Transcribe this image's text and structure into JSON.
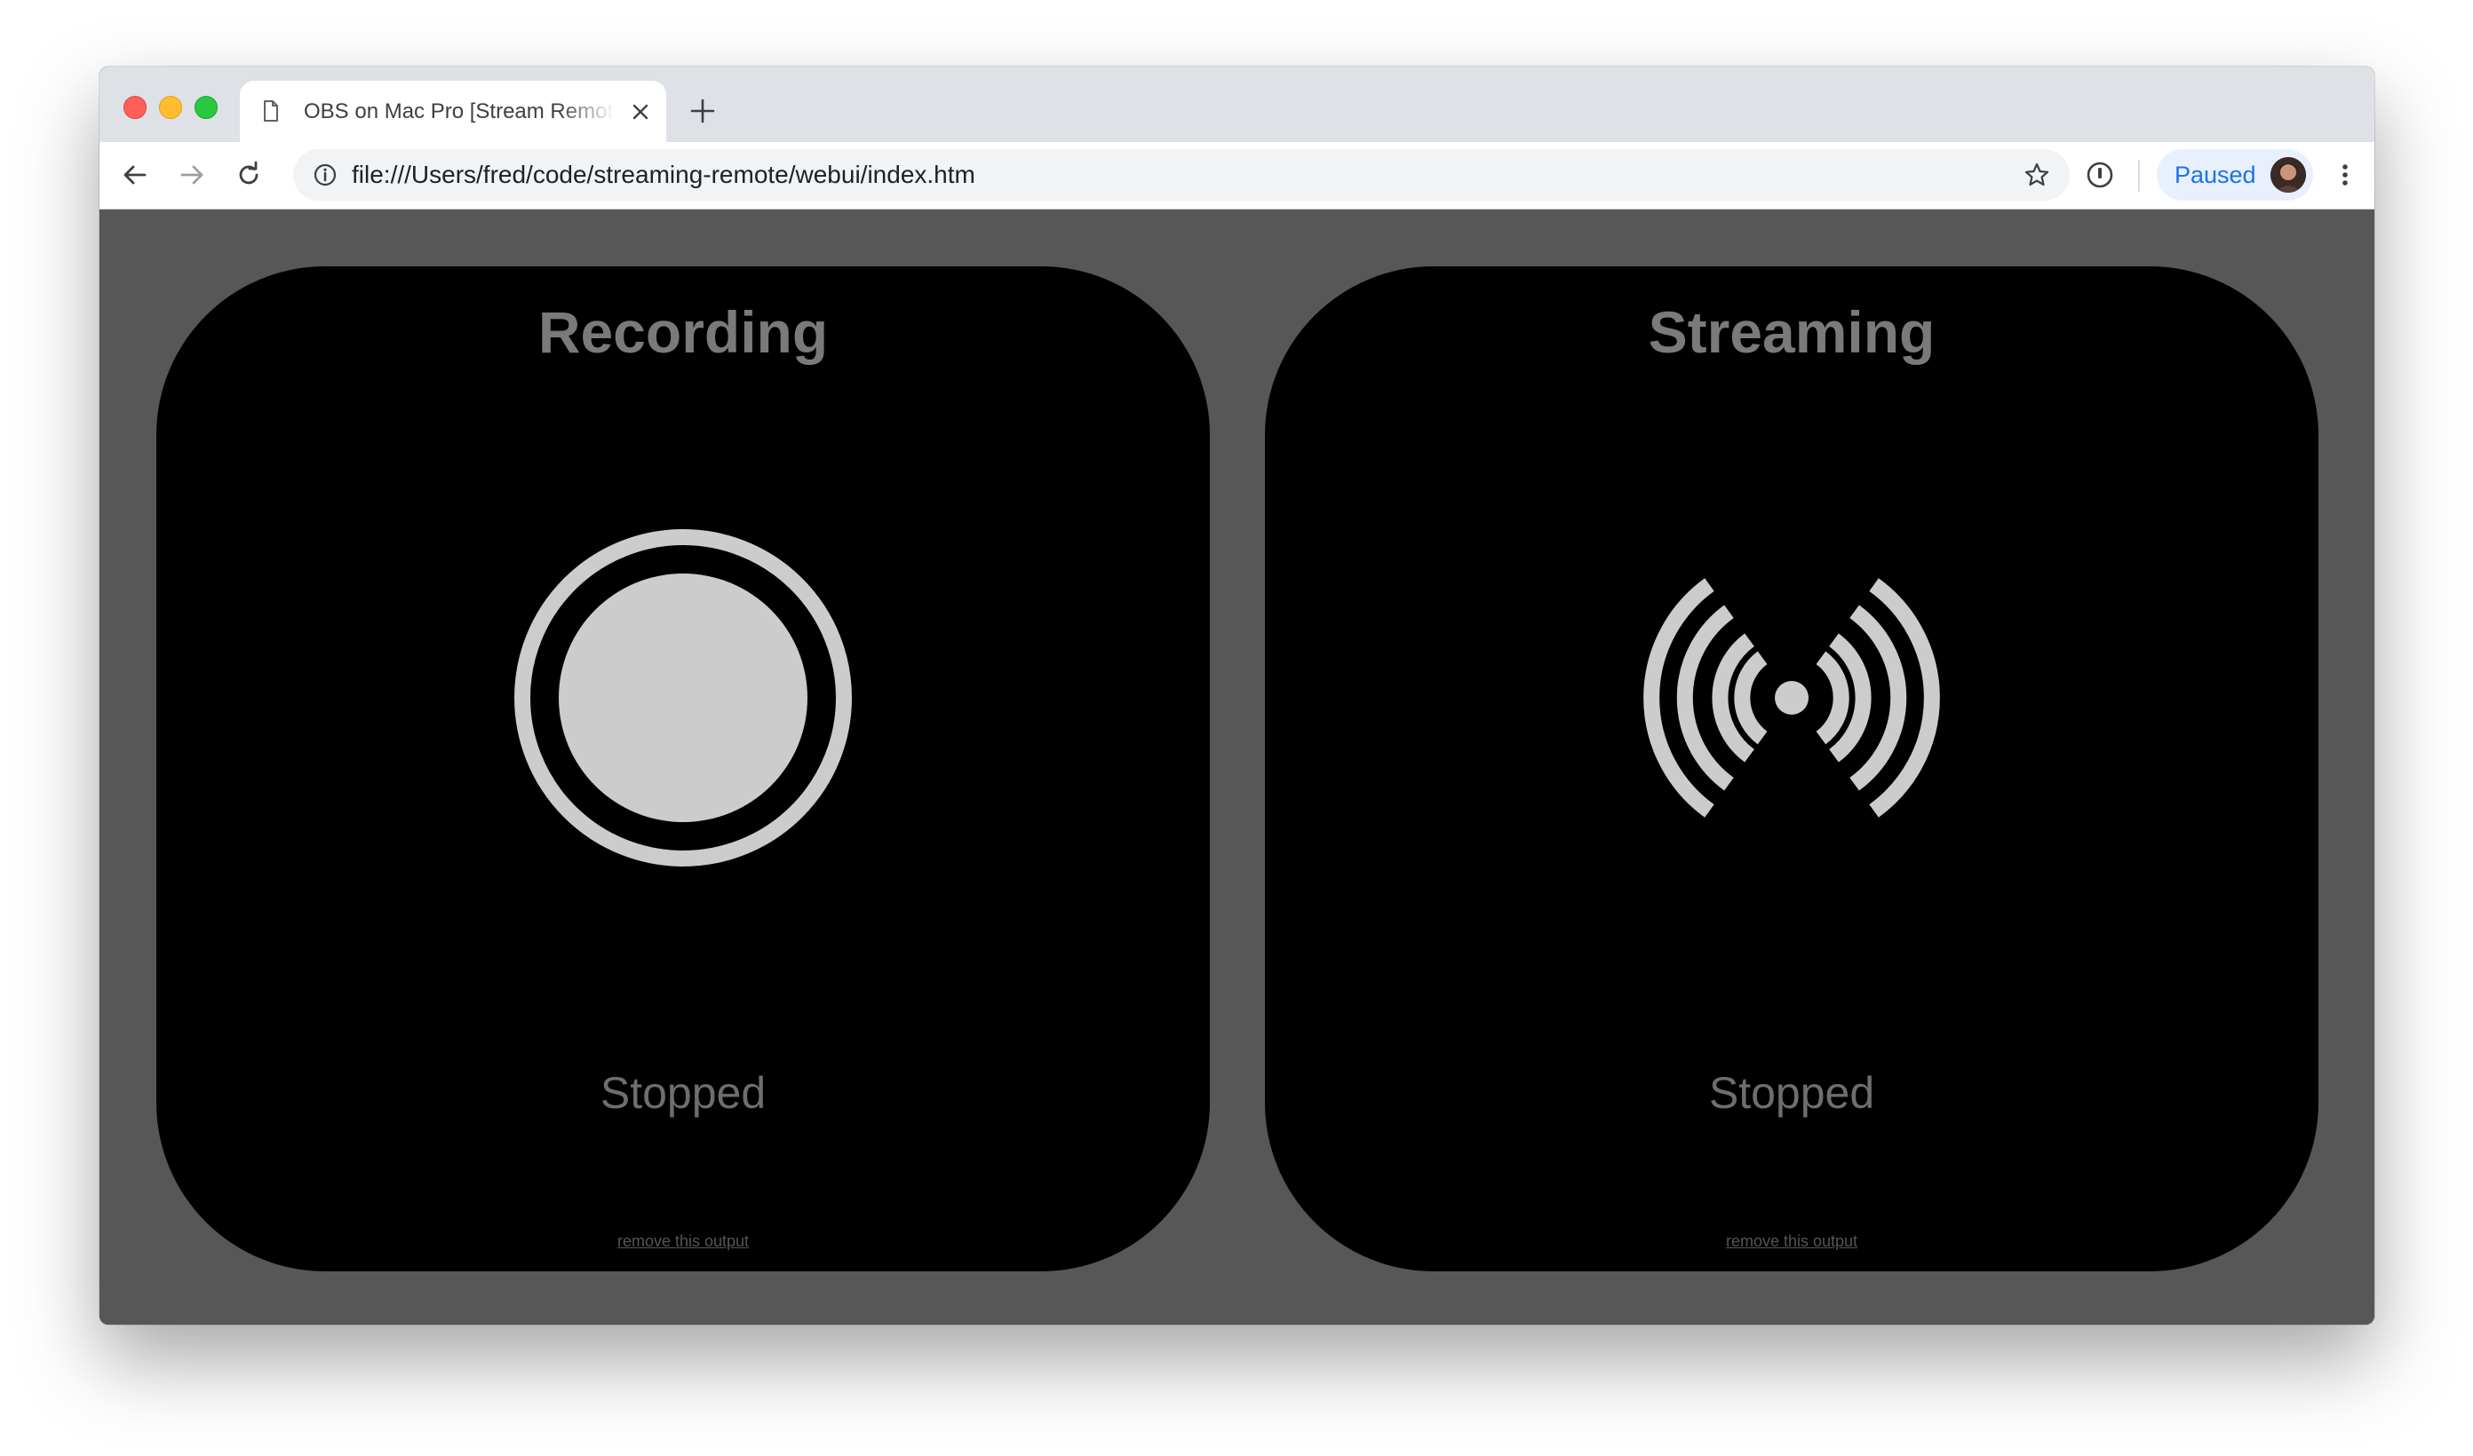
{
  "browser": {
    "tab": {
      "title": "OBS on Mac Pro [Stream Remote]",
      "file_icon": "document-icon",
      "close_icon": "close-icon"
    },
    "new_tab_icon": "plus-icon",
    "toolbar": {
      "back_icon": "arrow-left-icon",
      "forward_icon": "arrow-right-icon",
      "reload_icon": "reload-icon",
      "url": "file:///Users/fred/code/streaming-remote/webui/index.htm",
      "site_info_icon": "info-icon",
      "bookmark_icon": "star-icon",
      "extension_icon": "password-manager-icon",
      "profile_label": "Paused",
      "menu_icon": "kebab-menu-icon"
    },
    "colors": {
      "tab_strip": "#dee1e6",
      "profile_accent": "#1a73e8"
    }
  },
  "page": {
    "background": "#575757",
    "panels": [
      {
        "title": "Recording",
        "icon": "record-icon",
        "status": "Stopped",
        "remove_link": "remove this output"
      },
      {
        "title": "Streaming",
        "icon": "broadcast-icon",
        "status": "Stopped",
        "remove_link": "remove this output"
      }
    ]
  }
}
